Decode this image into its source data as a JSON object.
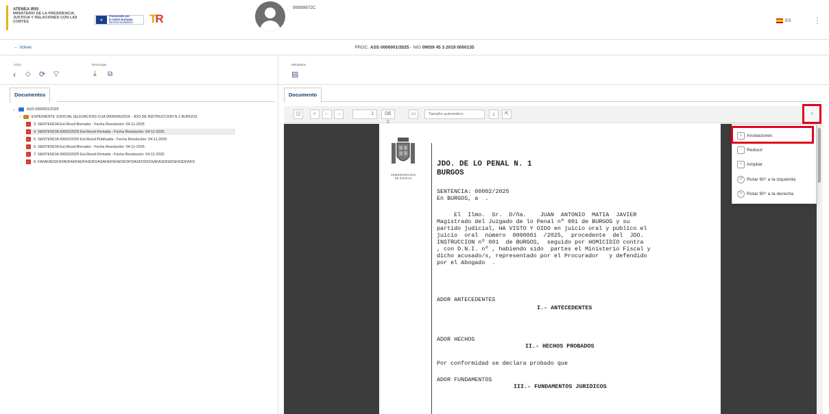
{
  "header": {
    "brand_lines": [
      "ATENEA IRIS",
      "MINISTERIO DE LA PRESIDENCIA,",
      "JUSTICIA Y RELACIONES CON LAS",
      "CORTES"
    ],
    "eu_lines": [
      "Financiado por",
      "la Unión Europea",
      "NextGenerationEU"
    ],
    "user_id": "99999972C",
    "language": "ES"
  },
  "subbar": {
    "back_label": "← Volver",
    "proc_prefix": "PROC.",
    "proc_bold_1": "ASS 0000001/2025",
    "proc_middle": "- NIG",
    "proc_bold_2": "09059 45 3 2019 0000135"
  },
  "toolbar": {
    "arbol_label": "Árbol",
    "descargas_label": "Descargas",
    "metadatos_label": "Metadatos"
  },
  "tabs": {
    "left": "Documentos",
    "right": "Documento"
  },
  "tree": {
    "root": "ASS 0000001/2025",
    "folder": "EXPEDIENTE JUDICIAL (ELEVACION) CUA 0000045/2019 - JDO.DE INSTRUCCION N.1 BURGOS",
    "items": [
      "3. SENTENCIA Est.Resol:Borrador - Fecha Resolución: 04-11-2025",
      "4. SENTENCIA 00002/2025 Est.Resol:Firmada - Fecha Resolución: 04-11-2025",
      "5. SENTENCIA 00002/2025 Est.Resol:Publicada - Fecha Resolución: 04-11-2025",
      "6. SENTENCIA Est.Resol:Borrador - Fecha Resolución: 04-11-2025",
      "7. SENTENCIA 00003/2025 Est.Resol:Firmada - Fecha Resolución: 04-11-2025",
      "8. FAFAFADSFDFADFADFADFASDFDASAFADSFADSFDFDASFDSFDSAFASDFADSFASDFADS"
    ]
  },
  "viewer": {
    "page_number": "1",
    "page_total": "DE 2",
    "zoom": "Tamaño automático"
  },
  "document": {
    "admin_lines": [
      "ADMINISTRACION",
      "DE JUSTICIA"
    ],
    "court_line_1": "JDO. DE LO PENAL N. 1",
    "court_line_2": "BURGOS",
    "body_lines": [
      "SENTENCIA: 00002/2025",
      "En BURGOS, a  .",
      "",
      "     El  Ilmo.  Sr.  D/ña.    JUAN  ANTONIO  MATIA  JAVIER",
      "Magistrado del Juzgado de lo Penal nº 001 de BURGOS y su",
      "partido judicial, HA VISTO Y OIDO en juicio oral y público el",
      "juicio  oral  número  0000001  /2025,  procedente  del  JDO.",
      "INSTRUCCION nº 001  de BURGOS,  seguido por HOMICIDIO contra",
      ", con D.N.I. nº , habiendo sido  partes el Ministerio Fiscal y",
      "dicho acusado/s, representado por el Procurador   y defendido",
      "por el Abogado  ."
    ],
    "antecedentes_tag": "ADOR ANTECEDENTES",
    "antecedentes_title": "I.- ANTECEDENTES",
    "hechos_tag": "ADOR HECHOS",
    "hechos_title": "II.- HECHOS PROBADOS",
    "hechos_text": "Por conformidad se declara probado que",
    "fundamentos_tag": "ADOR FUNDAMENTOS",
    "fundamentos_title": "III.- FUNDAMENTOS JURIDICOS"
  },
  "context_menu": {
    "items": [
      "Anotaciones",
      "Reducir",
      "Ampliar",
      "Rotar 90° a la izquierda",
      "Rotar 90° a la derecha"
    ]
  }
}
